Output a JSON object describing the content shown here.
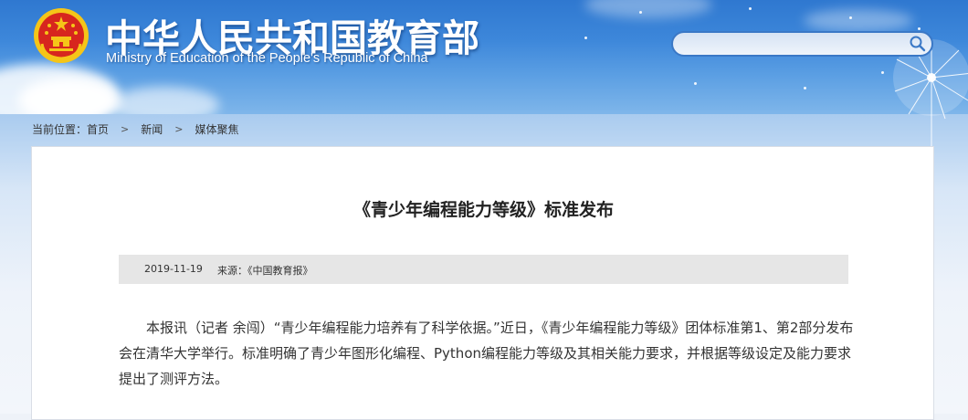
{
  "header": {
    "site_title": "中华人民共和国教育部",
    "site_subtitle": "Ministry of Education of the People's Republic of China",
    "emblem_icon": "national-emblem-icon"
  },
  "search": {
    "placeholder": "",
    "value": "",
    "icon": "search-icon"
  },
  "breadcrumb": {
    "prefix": "当前位置：",
    "items": [
      "首页",
      "新闻",
      "媒体聚焦"
    ],
    "separator_icon": "chevron-right-icon"
  },
  "article": {
    "title": "《青少年编程能力等级》标准发布",
    "date": "2019-11-19",
    "source": "来源：《中国教育报》",
    "body": "本报讯（记者 余闯）“青少年编程能力培养有了科学依据。”近日，《青少年编程能力等级》团体标准第1、第2部分发布会在清华大学举行。标准明确了青少年图形化编程、Python编程能力等级及其相关能力要求，并根据等级设定及能力要求提出了测评方法。"
  },
  "colors": {
    "header_sky": "#3d87da",
    "search_border": "#3a78c6",
    "meta_bar_bg": "#e6e6e6",
    "emblem_red": "#d7261e",
    "emblem_gold": "#f5c518"
  }
}
